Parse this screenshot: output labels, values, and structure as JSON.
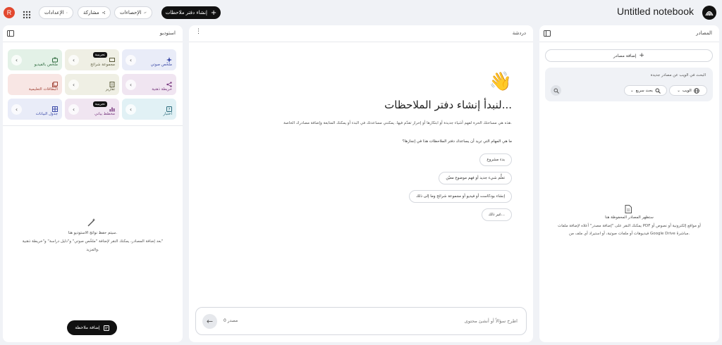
{
  "topbar": {
    "avatar_letter": "R",
    "settings_label": "الإعدادات",
    "share_label": "مشاركة",
    "analytics_label": "الإحصاءات",
    "create_notebook_label": "إنشاء دفتر ملاحظات",
    "notebook_title": "Untitled notebook"
  },
  "studio": {
    "title": "استوديو",
    "cards": [
      {
        "label": "ملخّص صوتي",
        "icon": "audio-sparkle-icon",
        "bg": "#e9ecf8",
        "fg": "#3b4aa8"
      },
      {
        "label": "مجموعة شرائح",
        "icon": "slides-icon",
        "bg": "#efefe4",
        "fg": "#5c5c3d",
        "badge": "تجريبية"
      },
      {
        "label": "ملخّص بالفيديو",
        "icon": "video-icon",
        "bg": "#e3f1e7",
        "fg": "#2d6b3e"
      },
      {
        "label": "خريطة ذهنية",
        "icon": "mind-map-icon",
        "bg": "#f0e5f1",
        "fg": "#7a3b80"
      },
      {
        "label": "تقارير",
        "icon": "report-icon",
        "bg": "#efefe4",
        "fg": "#5c5c3d"
      },
      {
        "label": "البطاقات التعليمية",
        "icon": "flashcards-icon",
        "bg": "#f8e6e4",
        "fg": "#a3463a"
      },
      {
        "label": "اختبار",
        "icon": "quiz-icon",
        "bg": "#e1f1f5",
        "fg": "#2a6b7c"
      },
      {
        "label": "مخطط بياني",
        "icon": "chart-icon",
        "bg": "#f0e5f1",
        "fg": "#7a3b80",
        "badge": "تجريبية"
      },
      {
        "label": "جدول البيانات",
        "icon": "table-icon",
        "bg": "#e9ecf8",
        "fg": "#3b4aa8"
      }
    ],
    "empty_title": "سيتم حفظ نواتج الاستوديو هنا.",
    "empty_desc_1": "بعد إضافة المصادر، يمكنك النقر لإضافة \"ملخّص صوتي\" و\"دليل دراسة\" و\"خريطة ذهنية\"",
    "empty_desc_2": "والمزيد.",
    "add_note_label": "إضافة ملاحظة"
  },
  "chat": {
    "title": "دردشة",
    "emoji": "👋",
    "heading": "لنبدأ إنشاء دفتر الملاحظات...",
    "intro": "هذه هي مساحتك الحرة لفهم أشياء جديدة أو ابتكارها أو إحراز تقدّم فيها. يمكنني مساعدتك في البدء أو يمكنك المتابعة وإضافة مصادرك الخاصة.",
    "question": "ما هي المهام التي تريد أن يساعدك دفتر الملاحظات هذا في إنجازها؟",
    "suggestions": [
      "بدء مشروع",
      "تعلُّم شيء جديد أو فهم موضوع معيّن",
      "إنشاء بودكاست أو فيديو أو مجموعة شرائح وما إلى ذلك",
      "غير ذلك..."
    ],
    "input_placeholder": "اطرح سؤالاً أو أنشئ محتوى",
    "source_count": "0 مصدر"
  },
  "sources": {
    "title": "المصادر",
    "add_sources_label": "إضافة مصادر",
    "search_hint": "البحث في الويب عن مصادر جديدة",
    "web_chip": "الويب",
    "fast_search_chip": "بحث سريع",
    "empty_title": "ستظهر المصادر المحفوظة هنا",
    "empty_desc_1": "يمكنك النقر على \"إضافة مصدر\" أعلاه لإضافة ملفات PDF أو مواقع إلكترونية أو نصوص أو",
    "empty_desc_2": "فيديوهات أو ملفات صوتية، أو استيراد أي ملف من Google Drive مباشرةً."
  },
  "colors": {
    "accent": "#111111",
    "panel_bg": "#ffffff",
    "page_bg": "#f0f2f6",
    "avatar": "#e2482f"
  }
}
